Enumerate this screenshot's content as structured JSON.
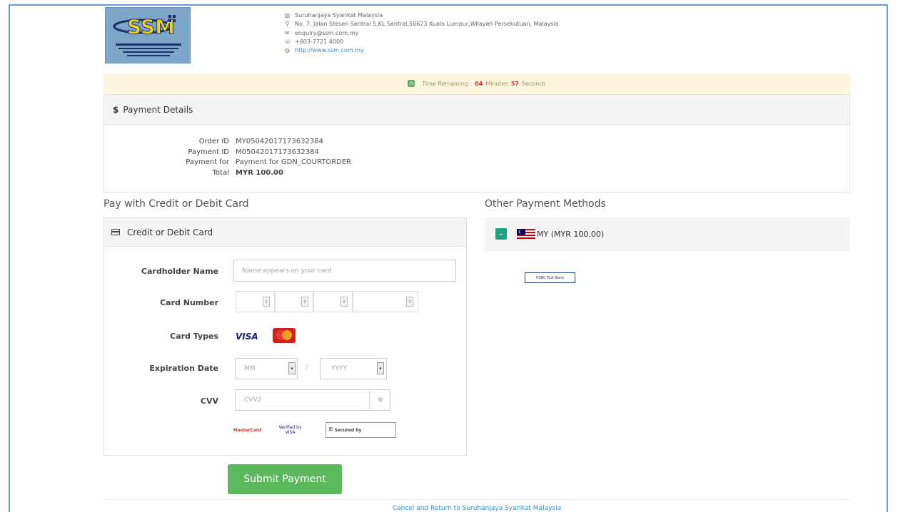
{
  "header": {
    "logo_text": "SSM",
    "org_name": "Suruhanjaya Syarikat Malaysia",
    "address": "No. 7, Jalan Stesen Sentral 5,KL Sentral,50623 Kuala Lumpur,Wilayah Persekutuan, Malaysia",
    "email": "enquiry@ssm.com.my",
    "phone": "+603-7721 4000",
    "website": "http://www.ssm.com.my"
  },
  "timer": {
    "prefix": "Time Remaining :",
    "minutes": "04",
    "minutes_label": "Minutes",
    "seconds": "57",
    "seconds_label": "Seconds"
  },
  "payment_details": {
    "title": "Payment Details",
    "rows": [
      {
        "key": "Order ID",
        "value": "MY05042017173632384"
      },
      {
        "key": "Payment ID",
        "value": "M05042017173632384"
      },
      {
        "key": "Payment for",
        "value": "Payment for GDN_COURTORDER"
      },
      {
        "key": "Total",
        "value": "MYR 100.00"
      }
    ]
  },
  "card_section": {
    "title": "Pay with Credit or Debit Card",
    "panel_title": "Credit or Debit Card",
    "cardholder_label": "Cardholder Name",
    "cardholder_placeholder": "Name appears on your card",
    "card_number_label": "Card Number",
    "card_types_label": "Card Types",
    "visa_text": "VISA",
    "expiration_label": "Expiration Date",
    "month_placeholder": "MM",
    "separator": "/",
    "year_placeholder": "YYYY",
    "cvv_label": "CVV",
    "cvv_placeholder": "CVV2",
    "badge_mastercard": "MasterCard",
    "badge_verified_visa": "Verified by VISA",
    "badge_secured": "Secured by"
  },
  "submit_label": "Submit Payment",
  "cancel_label": "Cancel and Return to Suruhanjaya Syarikat Malaysia",
  "other_methods": {
    "title": "Other Payment Methods",
    "country_label": "MY (MYR 100.00)",
    "bank_label": "HSBC Test Bank"
  },
  "colors": {
    "submit_green": "#5cb85c",
    "timer_bg": "#fcf6e0",
    "minus_teal": "#1ba37d",
    "frame_blue": "#6b9bd8"
  }
}
